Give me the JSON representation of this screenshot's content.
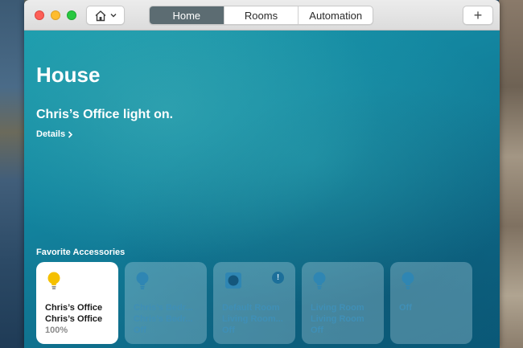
{
  "toolbar": {
    "tabs": [
      {
        "label": "Home",
        "active": true
      },
      {
        "label": "Rooms",
        "active": false
      },
      {
        "label": "Automation",
        "active": false
      }
    ],
    "add_label": "+"
  },
  "main": {
    "home_name": "House",
    "status": "Chris’s Office light on.",
    "details_label": "Details",
    "favorites_heading": "Favorite Accessories",
    "accessories": [
      {
        "icon": "lightbulb-icon",
        "room": "Chris’s Office",
        "name": "Chris’s Office",
        "state": "100%",
        "on": true
      },
      {
        "icon": "lightbulb-icon",
        "room": "Chris’s Bedr...",
        "name": "Chris’s Bedr...",
        "state": "Off",
        "on": false
      },
      {
        "icon": "outlet-icon",
        "room": "Default Room",
        "name": "Living Room...",
        "state": "Off",
        "on": false,
        "alert": "!"
      },
      {
        "icon": "lightbulb-icon",
        "room": "Living Room",
        "name": "Living Room",
        "state": "Off",
        "on": false
      },
      {
        "icon": "lightbulb-icon",
        "room": "",
        "name": "",
        "state": "Off",
        "on": false
      }
    ]
  },
  "colors": {
    "accent_active_tab": "#5c6c72",
    "bulb_on": "#f5c000",
    "off_text": "#3f8fb6"
  }
}
